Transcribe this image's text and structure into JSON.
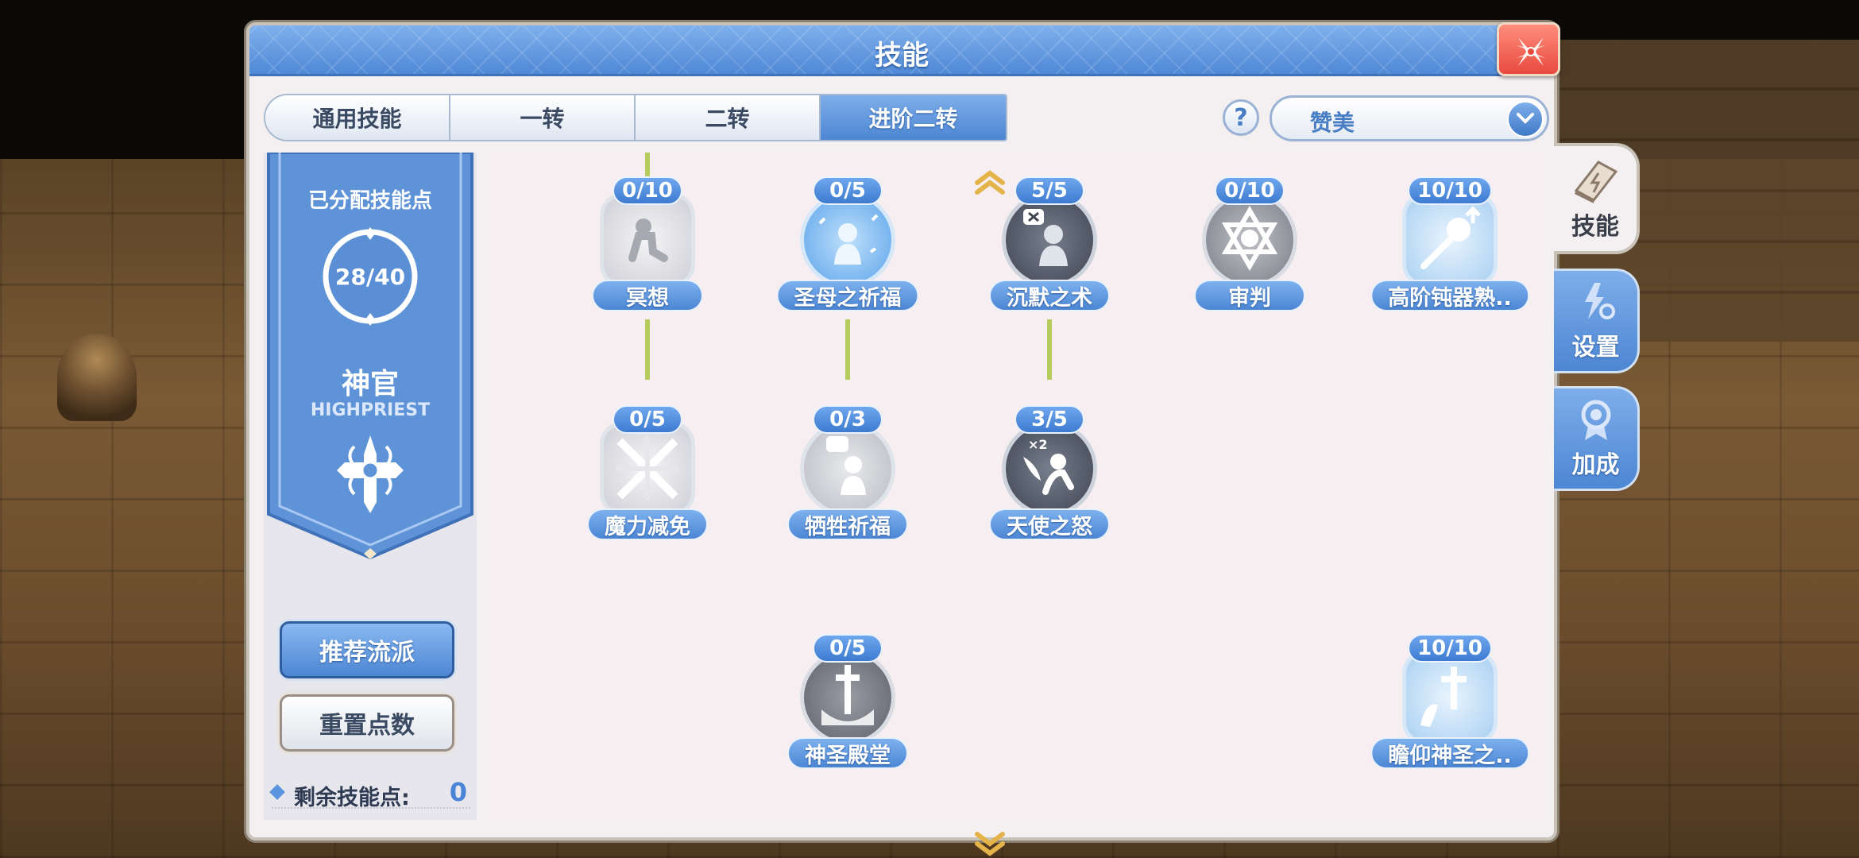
{
  "window": {
    "title": "技能"
  },
  "tabs": [
    {
      "label": "通用技能",
      "active": false
    },
    {
      "label": "一转",
      "active": false
    },
    {
      "label": "二转",
      "active": false
    },
    {
      "label": "进阶二转",
      "active": true
    }
  ],
  "build_selector": {
    "help": "?",
    "selected": "赞美"
  },
  "class_panel": {
    "title": "已分配技能点",
    "points_used": "28/40",
    "class_name": "神官",
    "class_name_en": "HIGHPRIEST",
    "recommend_button": "推荐流派",
    "reset_button": "重置点数",
    "remaining_label": "剩余技能点:",
    "remaining_value": "0"
  },
  "skills": [
    {
      "name": "冥想",
      "level": "0/10",
      "icon": "meditation-icon",
      "learned": false
    },
    {
      "name": "圣母之祈福",
      "level": "0/5",
      "icon": "blessing-icon",
      "learned": false
    },
    {
      "name": "沉默之术",
      "level": "5/5",
      "icon": "silence-icon",
      "learned": true
    },
    {
      "name": "审判",
      "level": "0/10",
      "icon": "judgement-star-icon",
      "learned": false
    },
    {
      "name": "高阶钝器熟..",
      "level": "10/10",
      "icon": "mace-mastery-icon",
      "learned": true
    },
    {
      "name": "魔力减免",
      "level": "0/5",
      "icon": "magic-reduction-icon",
      "learned": false
    },
    {
      "name": "牺牲祈福",
      "level": "0/3",
      "icon": "sacrifice-icon",
      "learned": false
    },
    {
      "name": "天使之怒",
      "level": "3/5",
      "icon": "angel-wrath-icon",
      "learned": true
    },
    {
      "name": "神圣殿堂",
      "level": "0/5",
      "icon": "sanctuary-icon",
      "learned": false
    },
    {
      "name": "瞻仰神圣之..",
      "level": "10/10",
      "icon": "holy-cross-icon",
      "learned": true
    }
  ],
  "side_tabs": [
    {
      "label": "技能",
      "icon": "skill-book-icon",
      "active": true
    },
    {
      "label": "设置",
      "icon": "lightning-gear-icon",
      "active": false
    },
    {
      "label": "加成",
      "icon": "medal-icon",
      "active": false
    }
  ],
  "colors": {
    "accent": "#4d86d3",
    "connector": "#b6cc5c",
    "close": "#e84a3e"
  }
}
